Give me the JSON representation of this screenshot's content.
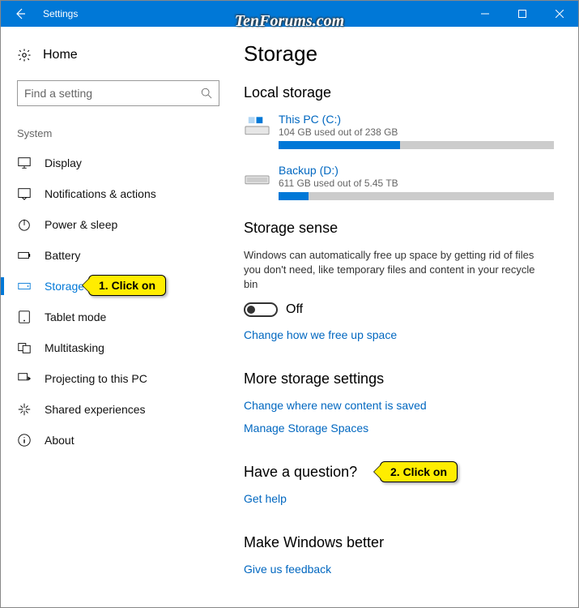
{
  "watermark": "TenForums.com",
  "window": {
    "title": "Settings"
  },
  "sidebar": {
    "home": "Home",
    "search_placeholder": "Find a setting",
    "group": "System",
    "items": [
      {
        "label": "Display"
      },
      {
        "label": "Notifications & actions"
      },
      {
        "label": "Power & sleep"
      },
      {
        "label": "Battery"
      },
      {
        "label": "Storage",
        "selected": true
      },
      {
        "label": "Tablet mode"
      },
      {
        "label": "Multitasking"
      },
      {
        "label": "Projecting to this PC"
      },
      {
        "label": "Shared experiences"
      },
      {
        "label": "About"
      }
    ]
  },
  "callouts": {
    "c1": "1. Click on",
    "c2": "2. Click on"
  },
  "main": {
    "title": "Storage",
    "local_storage": {
      "heading": "Local storage",
      "disks": [
        {
          "name": "This PC (C:)",
          "sub": "104 GB used out of 238 GB",
          "pct": 44
        },
        {
          "name": "Backup (D:)",
          "sub": "611 GB used out of 5.45 TB",
          "pct": 11
        }
      ]
    },
    "storage_sense": {
      "heading": "Storage sense",
      "desc": "Windows can automatically free up space by getting rid of files you don't need, like temporary files and content in your recycle bin",
      "toggle_label": "Off",
      "link": "Change how we free up space"
    },
    "more": {
      "heading": "More storage settings",
      "link1": "Change where new content is saved",
      "link2": "Manage Storage Spaces"
    },
    "question": {
      "heading": "Have a question?",
      "link": "Get help"
    },
    "feedback": {
      "heading": "Make Windows better",
      "link": "Give us feedback"
    }
  }
}
